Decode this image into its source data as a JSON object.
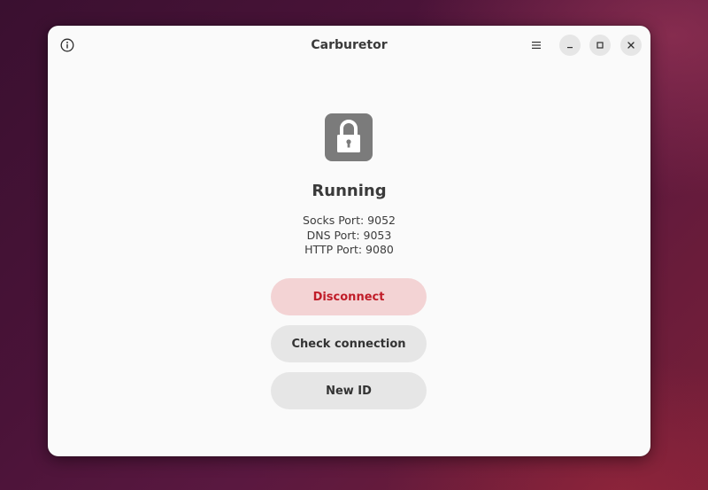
{
  "window": {
    "title": "Carburetor"
  },
  "header": {
    "info_icon": "info-icon",
    "menu_icon": "hamburger-menu-icon",
    "minimize_icon": "minimize-icon",
    "maximize_icon": "maximize-icon",
    "close_icon": "close-icon"
  },
  "main": {
    "status_icon": "lock-icon",
    "status": "Running",
    "ports": [
      "Socks Port: 9052",
      "DNS Port: 9053",
      "HTTP Port: 9080"
    ],
    "buttons": {
      "disconnect": "Disconnect",
      "check_connection": "Check connection",
      "new_id": "New ID"
    }
  },
  "colors": {
    "destructive_text": "#c01c28",
    "destructive_bg": "#f3d3d4",
    "button_bg": "#e6e6e6",
    "window_bg": "#fafafa",
    "icon_bg": "#7b7b7b"
  }
}
